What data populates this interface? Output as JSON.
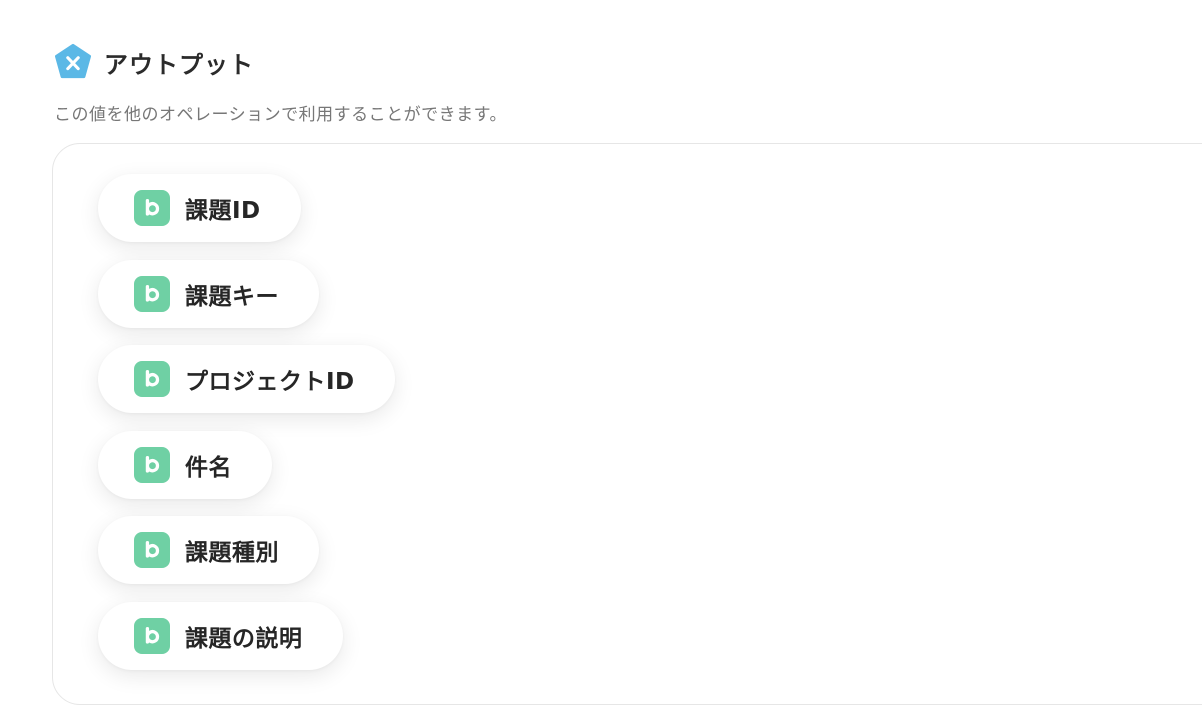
{
  "header": {
    "title": "アウトプット",
    "icon": "pentagon-x-icon",
    "icon_color": "#5bb8e6"
  },
  "description": "この値を他のオペレーションで利用することができます。",
  "outputs": {
    "icon": "backlog-b-icon",
    "icon_color": "#6fd0a4",
    "items": [
      {
        "label": "課題ID"
      },
      {
        "label": "課題キー"
      },
      {
        "label": "プロジェクトID"
      },
      {
        "label": "件名"
      },
      {
        "label": "課題種別"
      },
      {
        "label": "課題の説明"
      }
    ]
  }
}
